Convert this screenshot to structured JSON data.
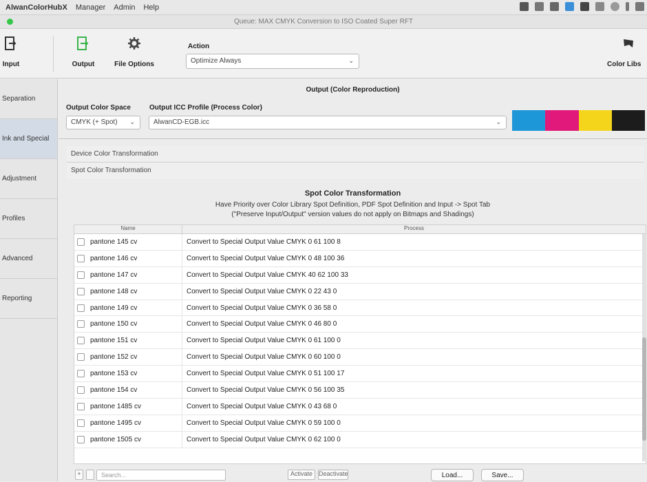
{
  "menubar": {
    "app_name": "AlwanColorHubX",
    "items": [
      "Manager",
      "Admin",
      "Help"
    ]
  },
  "window": {
    "title": "Queue: MAX CMYK Conversion to ISO Coated Super RFT"
  },
  "toolbar": {
    "input_label": "Input",
    "output_label": "Output",
    "file_options_label": "File Options",
    "action_label": "Action",
    "action_value": "Optimize Always",
    "color_libs_label": "Color Libs"
  },
  "sidebar": {
    "items": [
      {
        "label": "Separation"
      },
      {
        "label": "Ink and Special"
      },
      {
        "label": "Adjustment"
      },
      {
        "label": "Profiles"
      },
      {
        "label": "Advanced"
      },
      {
        "label": "Reporting"
      }
    ]
  },
  "output": {
    "section_title": "Output (Color Reproduction)",
    "color_space_label": "Output Color Space",
    "color_space_value": "CMYK (+ Spot)",
    "profile_label": "Output ICC Profile (Process Color)",
    "profile_value": "AlwanCD-EGB.icc",
    "swatches": [
      "#1e97d8",
      "#e0197a",
      "#f5d51b",
      "#1c1c1c"
    ]
  },
  "sections": {
    "device_transform": "Device Color Transformation",
    "spot_transform": "Spot Color Transformation"
  },
  "spot": {
    "title": "Spot Color Transformation",
    "subtitle1": "Have Priority over Color Library Spot Definition, PDF Spot Definition and Input -> Spot Tab",
    "subtitle2": "(\"Preserve Input/Output\" version values do not apply on Bitmaps and Shadings)"
  },
  "table": {
    "col_name": "Name",
    "col_process": "Process",
    "rows": [
      {
        "name": "pantone 145 cv",
        "process": "Convert to Special Output Value CMYK 0 61 100 8"
      },
      {
        "name": "pantone 146 cv",
        "process": "Convert to Special Output Value CMYK 0 48 100 36"
      },
      {
        "name": "pantone 147 cv",
        "process": "Convert to Special Output Value CMYK 40 62 100 33"
      },
      {
        "name": "pantone 148 cv",
        "process": "Convert to Special Output Value CMYK 0 22 43 0"
      },
      {
        "name": "pantone 149 cv",
        "process": "Convert to Special Output Value CMYK 0 36 58 0"
      },
      {
        "name": "pantone 150 cv",
        "process": "Convert to Special Output Value CMYK 0 46 80 0"
      },
      {
        "name": "pantone 151 cv",
        "process": "Convert to Special Output Value CMYK 0 61 100 0"
      },
      {
        "name": "pantone 152 cv",
        "process": "Convert to Special Output Value CMYK 0 60 100 0"
      },
      {
        "name": "pantone 153 cv",
        "process": "Convert to Special Output Value CMYK 0 51 100 17"
      },
      {
        "name": "pantone 154 cv",
        "process": "Convert to Special Output Value CMYK 0 56 100 35"
      },
      {
        "name": "pantone 1485 cv",
        "process": "Convert to Special Output Value CMYK 0 43 68 0"
      },
      {
        "name": "pantone 1495 cv",
        "process": "Convert to Special Output Value CMYK 0 59 100 0"
      },
      {
        "name": "pantone 1505 cv",
        "process": "Convert to Special Output Value CMYK 0 62 100 0"
      }
    ]
  },
  "footer": {
    "search_placeholder": "Search...",
    "activate_label": "Activate",
    "deactivate_label": "Deactivate",
    "load_label": "Load...",
    "save_label": "Save..."
  }
}
